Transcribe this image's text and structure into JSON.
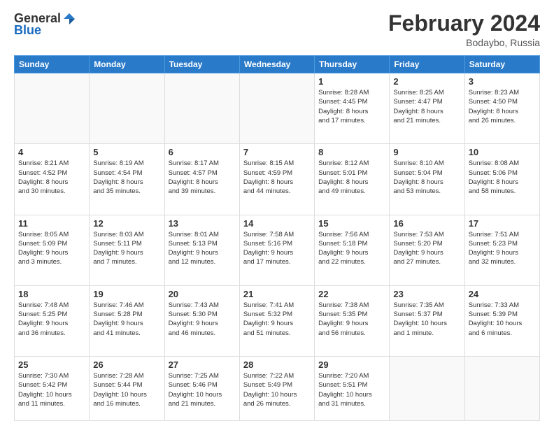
{
  "header": {
    "logo_general": "General",
    "logo_blue": "Blue",
    "month_title": "February 2024",
    "subtitle": "Bodaybo, Russia"
  },
  "days_of_week": [
    "Sunday",
    "Monday",
    "Tuesday",
    "Wednesday",
    "Thursday",
    "Friday",
    "Saturday"
  ],
  "weeks": [
    [
      {
        "day": "",
        "info": ""
      },
      {
        "day": "",
        "info": ""
      },
      {
        "day": "",
        "info": ""
      },
      {
        "day": "",
        "info": ""
      },
      {
        "day": "1",
        "info": "Sunrise: 8:28 AM\nSunset: 4:45 PM\nDaylight: 8 hours\nand 17 minutes."
      },
      {
        "day": "2",
        "info": "Sunrise: 8:25 AM\nSunset: 4:47 PM\nDaylight: 8 hours\nand 21 minutes."
      },
      {
        "day": "3",
        "info": "Sunrise: 8:23 AM\nSunset: 4:50 PM\nDaylight: 8 hours\nand 26 minutes."
      }
    ],
    [
      {
        "day": "4",
        "info": "Sunrise: 8:21 AM\nSunset: 4:52 PM\nDaylight: 8 hours\nand 30 minutes."
      },
      {
        "day": "5",
        "info": "Sunrise: 8:19 AM\nSunset: 4:54 PM\nDaylight: 8 hours\nand 35 minutes."
      },
      {
        "day": "6",
        "info": "Sunrise: 8:17 AM\nSunset: 4:57 PM\nDaylight: 8 hours\nand 39 minutes."
      },
      {
        "day": "7",
        "info": "Sunrise: 8:15 AM\nSunset: 4:59 PM\nDaylight: 8 hours\nand 44 minutes."
      },
      {
        "day": "8",
        "info": "Sunrise: 8:12 AM\nSunset: 5:01 PM\nDaylight: 8 hours\nand 49 minutes."
      },
      {
        "day": "9",
        "info": "Sunrise: 8:10 AM\nSunset: 5:04 PM\nDaylight: 8 hours\nand 53 minutes."
      },
      {
        "day": "10",
        "info": "Sunrise: 8:08 AM\nSunset: 5:06 PM\nDaylight: 8 hours\nand 58 minutes."
      }
    ],
    [
      {
        "day": "11",
        "info": "Sunrise: 8:05 AM\nSunset: 5:09 PM\nDaylight: 9 hours\nand 3 minutes."
      },
      {
        "day": "12",
        "info": "Sunrise: 8:03 AM\nSunset: 5:11 PM\nDaylight: 9 hours\nand 7 minutes."
      },
      {
        "day": "13",
        "info": "Sunrise: 8:01 AM\nSunset: 5:13 PM\nDaylight: 9 hours\nand 12 minutes."
      },
      {
        "day": "14",
        "info": "Sunrise: 7:58 AM\nSunset: 5:16 PM\nDaylight: 9 hours\nand 17 minutes."
      },
      {
        "day": "15",
        "info": "Sunrise: 7:56 AM\nSunset: 5:18 PM\nDaylight: 9 hours\nand 22 minutes."
      },
      {
        "day": "16",
        "info": "Sunrise: 7:53 AM\nSunset: 5:20 PM\nDaylight: 9 hours\nand 27 minutes."
      },
      {
        "day": "17",
        "info": "Sunrise: 7:51 AM\nSunset: 5:23 PM\nDaylight: 9 hours\nand 32 minutes."
      }
    ],
    [
      {
        "day": "18",
        "info": "Sunrise: 7:48 AM\nSunset: 5:25 PM\nDaylight: 9 hours\nand 36 minutes."
      },
      {
        "day": "19",
        "info": "Sunrise: 7:46 AM\nSunset: 5:28 PM\nDaylight: 9 hours\nand 41 minutes."
      },
      {
        "day": "20",
        "info": "Sunrise: 7:43 AM\nSunset: 5:30 PM\nDaylight: 9 hours\nand 46 minutes."
      },
      {
        "day": "21",
        "info": "Sunrise: 7:41 AM\nSunset: 5:32 PM\nDaylight: 9 hours\nand 51 minutes."
      },
      {
        "day": "22",
        "info": "Sunrise: 7:38 AM\nSunset: 5:35 PM\nDaylight: 9 hours\nand 56 minutes."
      },
      {
        "day": "23",
        "info": "Sunrise: 7:35 AM\nSunset: 5:37 PM\nDaylight: 10 hours\nand 1 minute."
      },
      {
        "day": "24",
        "info": "Sunrise: 7:33 AM\nSunset: 5:39 PM\nDaylight: 10 hours\nand 6 minutes."
      }
    ],
    [
      {
        "day": "25",
        "info": "Sunrise: 7:30 AM\nSunset: 5:42 PM\nDaylight: 10 hours\nand 11 minutes."
      },
      {
        "day": "26",
        "info": "Sunrise: 7:28 AM\nSunset: 5:44 PM\nDaylight: 10 hours\nand 16 minutes."
      },
      {
        "day": "27",
        "info": "Sunrise: 7:25 AM\nSunset: 5:46 PM\nDaylight: 10 hours\nand 21 minutes."
      },
      {
        "day": "28",
        "info": "Sunrise: 7:22 AM\nSunset: 5:49 PM\nDaylight: 10 hours\nand 26 minutes."
      },
      {
        "day": "29",
        "info": "Sunrise: 7:20 AM\nSunset: 5:51 PM\nDaylight: 10 hours\nand 31 minutes."
      },
      {
        "day": "",
        "info": ""
      },
      {
        "day": "",
        "info": ""
      }
    ]
  ]
}
